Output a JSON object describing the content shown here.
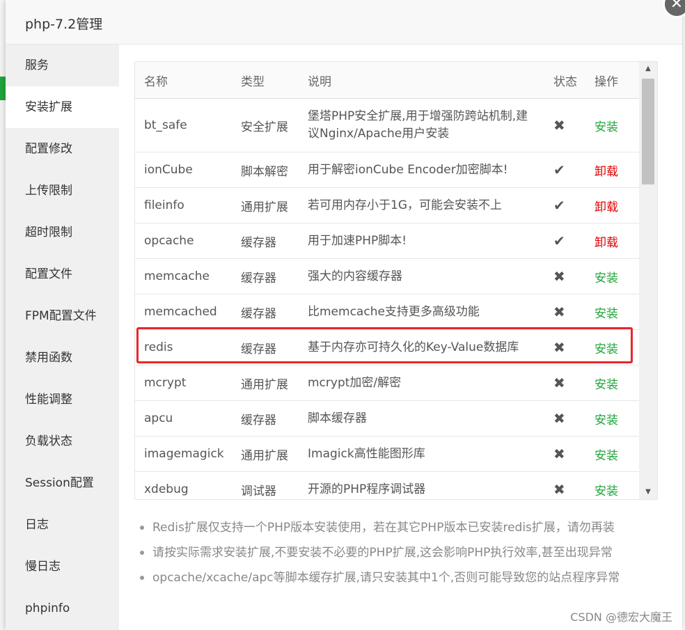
{
  "window": {
    "title": "php-7.2管理",
    "close_symbol": "✕"
  },
  "sidebar": {
    "items": [
      {
        "label": "服务"
      },
      {
        "label": "安装扩展",
        "active": true
      },
      {
        "label": "配置修改"
      },
      {
        "label": "上传限制"
      },
      {
        "label": "超时限制"
      },
      {
        "label": "配置文件"
      },
      {
        "label": "FPM配置文件"
      },
      {
        "label": "禁用函数"
      },
      {
        "label": "性能调整"
      },
      {
        "label": "负载状态"
      },
      {
        "label": "Session配置"
      },
      {
        "label": "日志"
      },
      {
        "label": "慢日志"
      },
      {
        "label": "phpinfo"
      }
    ]
  },
  "table": {
    "headers": [
      "名称",
      "类型",
      "说明",
      "状态",
      "操作"
    ],
    "rows": [
      {
        "name": "bt_safe",
        "type": "安全扩展",
        "desc": "堡塔PHP安全扩展,用于增强防跨站机制,建议Nginx/Apache用户安装",
        "status": "✖",
        "action": "安装"
      },
      {
        "name": "ionCube",
        "type": "脚本解密",
        "desc": "用于解密ionCube Encoder加密脚本!",
        "status": "✔",
        "action": "卸载"
      },
      {
        "name": "fileinfo",
        "type": "通用扩展",
        "desc": "若可用内存小于1G，可能会安装不上",
        "status": "✔",
        "action": "卸载"
      },
      {
        "name": "opcache",
        "type": "缓存器",
        "desc": "用于加速PHP脚本!",
        "status": "✔",
        "action": "卸载"
      },
      {
        "name": "memcache",
        "type": "缓存器",
        "desc": "强大的内容缓存器",
        "status": "✖",
        "action": "安装"
      },
      {
        "name": "memcached",
        "type": "缓存器",
        "desc": "比memcache支持更多高级功能",
        "status": "✖",
        "action": "安装"
      },
      {
        "name": "redis",
        "type": "缓存器",
        "desc": "基于内存亦可持久化的Key-Value数据库",
        "status": "✖",
        "action": "安装"
      },
      {
        "name": "mcrypt",
        "type": "通用扩展",
        "desc": "mcrypt加密/解密",
        "status": "✖",
        "action": "安装"
      },
      {
        "name": "apcu",
        "type": "缓存器",
        "desc": "脚本缓存器",
        "status": "✖",
        "action": "安装"
      },
      {
        "name": "imagemagick",
        "type": "通用扩展",
        "desc": "Imagick高性能图形库",
        "status": "✖",
        "action": "安装"
      },
      {
        "name": "xdebug",
        "type": "调试器",
        "desc": "开源的PHP程序调试器",
        "status": "✖",
        "action": "安装"
      }
    ]
  },
  "scroll": {
    "up": "▲",
    "down": "▼"
  },
  "notes": [
    "Redis扩展仅支持一个PHP版本安装使用，若在其它PHP版本已安装redis扩展，请勿再装",
    "请按实际需求安装扩展,不要安装不必要的PHP扩展,这会影响PHP执行效率,甚至出现异常",
    "opcache/xcache/apc等脚本缓存扩展,请只安装其中1个,否则可能导致您的站点程序异常"
  ],
  "watermark": "CSDN @德宏大魔王",
  "colors": {
    "install": "#20a53a",
    "uninstall": "#e00000",
    "highlight": "#e8262b"
  }
}
